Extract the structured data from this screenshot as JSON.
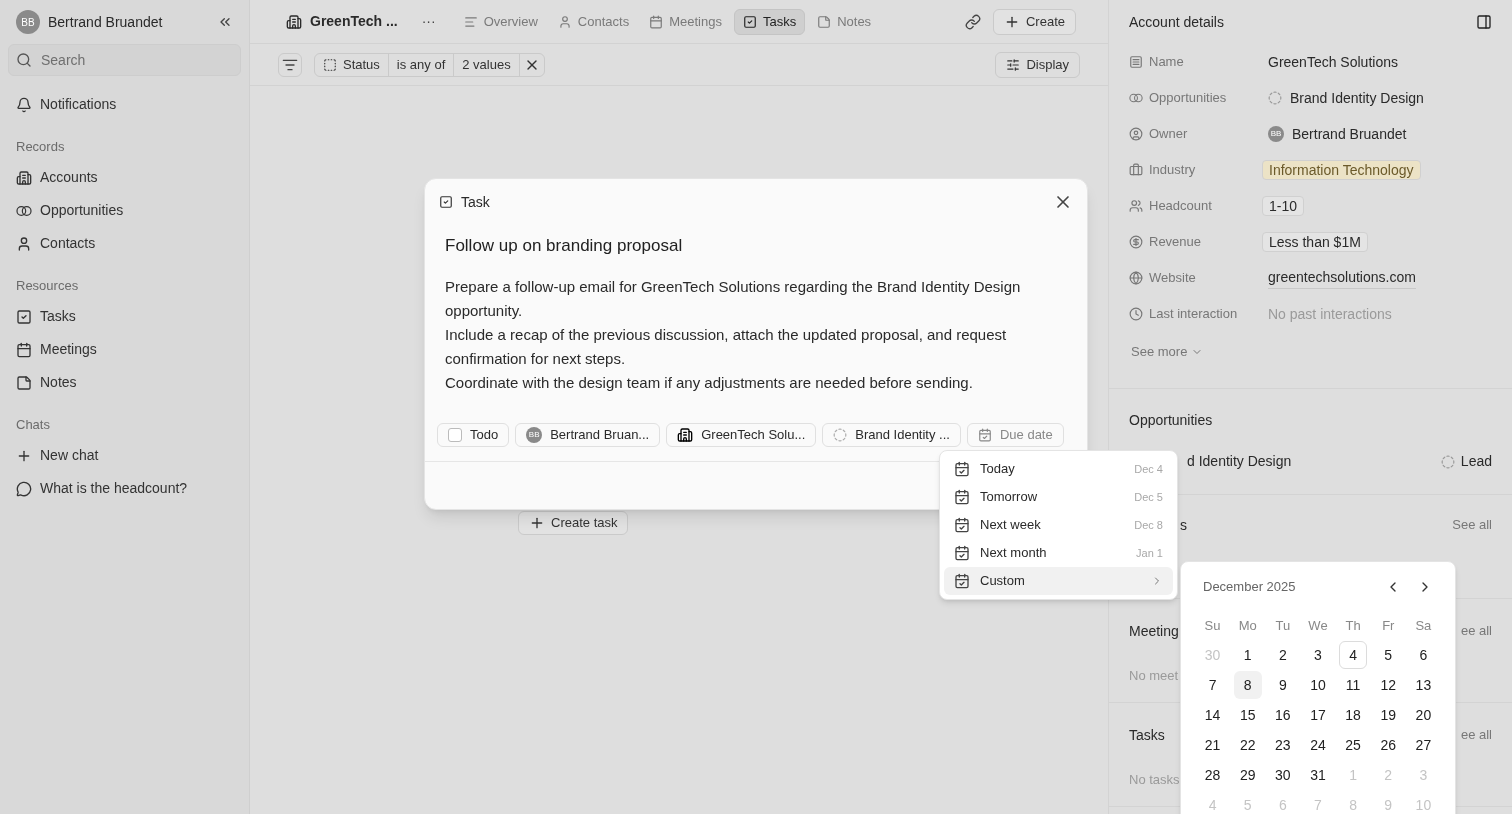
{
  "sidebar": {
    "user": {
      "initials": "BB",
      "name": "Bertrand Bruandet"
    },
    "search": {
      "placeholder": "Search"
    },
    "notifications": "Notifications",
    "sections": [
      {
        "title": "Records",
        "items": [
          "Accounts",
          "Opportunities",
          "Contacts"
        ]
      },
      {
        "title": "Resources",
        "items": [
          "Tasks",
          "Meetings",
          "Notes"
        ]
      },
      {
        "title": "Chats",
        "items": [
          "New chat",
          "What is the headcount?"
        ]
      }
    ]
  },
  "topbar": {
    "record": "GreenTech ...",
    "more": "···",
    "tabs": [
      {
        "label": "Overview",
        "selected": false
      },
      {
        "label": "Contacts",
        "selected": false
      },
      {
        "label": "Meetings",
        "selected": false
      },
      {
        "label": "Tasks",
        "selected": true
      },
      {
        "label": "Notes",
        "selected": false
      }
    ],
    "create": "Create"
  },
  "filter": {
    "field": "Status",
    "operator": "is any of",
    "value": "2 values",
    "display": "Display"
  },
  "create_task": "Create task",
  "task_modal": {
    "header": "Task",
    "title": "Follow up on branding proposal",
    "body": [
      "Prepare a follow-up email for GreenTech Solutions regarding the Brand Identity Design opportunity.",
      "Include a recap of the previous discussion, attach the updated proposal, and request confirmation for next steps.",
      "Coordinate with the design team if any adjustments are needed before sending."
    ],
    "chips": [
      {
        "kind": "status",
        "label": "Todo",
        "checked": false
      },
      {
        "kind": "owner",
        "label": "Bertrand Bruan...",
        "initials": "BB"
      },
      {
        "kind": "account",
        "label": "GreenTech Solu..."
      },
      {
        "kind": "opportunity",
        "label": "Brand Identity ..."
      },
      {
        "kind": "due",
        "label": "Due date"
      }
    ]
  },
  "due_menu": [
    {
      "label": "Today",
      "date": "Dec 4",
      "selected": false,
      "submenu": false
    },
    {
      "label": "Tomorrow",
      "date": "Dec 5",
      "selected": false,
      "submenu": false
    },
    {
      "label": "Next week",
      "date": "Dec 8",
      "selected": false,
      "submenu": false
    },
    {
      "label": "Next month",
      "date": "Jan 1",
      "selected": false,
      "submenu": false
    },
    {
      "label": "Custom",
      "selected": true,
      "submenu": true
    }
  ],
  "calendar": {
    "month": "December 2025",
    "weekdays": [
      "Su",
      "Mo",
      "Tu",
      "We",
      "Th",
      "Fr",
      "Sa"
    ],
    "weeks": [
      [
        {
          "label": "30",
          "outside": true,
          "today": false,
          "selected": false
        },
        {
          "label": "1",
          "outside": false,
          "today": false,
          "selected": false
        },
        {
          "label": "2",
          "outside": false,
          "today": false,
          "selected": false
        },
        {
          "label": "3",
          "outside": false,
          "today": false,
          "selected": false
        },
        {
          "label": "4",
          "outside": false,
          "today": true,
          "selected": false
        },
        {
          "label": "5",
          "outside": false,
          "today": false,
          "selected": false
        },
        {
          "label": "6",
          "outside": false,
          "today": false,
          "selected": false
        }
      ],
      [
        {
          "label": "7",
          "outside": false,
          "today": false,
          "selected": false
        },
        {
          "label": "8",
          "outside": false,
          "today": false,
          "selected": true
        },
        {
          "label": "9",
          "outside": false,
          "today": false,
          "selected": false
        },
        {
          "label": "10",
          "outside": false,
          "today": false,
          "selected": false
        },
        {
          "label": "11",
          "outside": false,
          "today": false,
          "selected": false
        },
        {
          "label": "12",
          "outside": false,
          "today": false,
          "selected": false
        },
        {
          "label": "13",
          "outside": false,
          "today": false,
          "selected": false
        }
      ],
      [
        {
          "label": "14",
          "outside": false,
          "today": false,
          "selected": false
        },
        {
          "label": "15",
          "outside": false,
          "today": false,
          "selected": false
        },
        {
          "label": "16",
          "outside": false,
          "today": false,
          "selected": false
        },
        {
          "label": "17",
          "outside": false,
          "today": false,
          "selected": false
        },
        {
          "label": "18",
          "outside": false,
          "today": false,
          "selected": false
        },
        {
          "label": "19",
          "outside": false,
          "today": false,
          "selected": false
        },
        {
          "label": "20",
          "outside": false,
          "today": false,
          "selected": false
        }
      ],
      [
        {
          "label": "21",
          "outside": false,
          "today": false,
          "selected": false
        },
        {
          "label": "22",
          "outside": false,
          "today": false,
          "selected": false
        },
        {
          "label": "23",
          "outside": false,
          "today": false,
          "selected": false
        },
        {
          "label": "24",
          "outside": false,
          "today": false,
          "selected": false
        },
        {
          "label": "25",
          "outside": false,
          "today": false,
          "selected": false
        },
        {
          "label": "26",
          "outside": false,
          "today": false,
          "selected": false
        },
        {
          "label": "27",
          "outside": false,
          "today": false,
          "selected": false
        }
      ],
      [
        {
          "label": "28",
          "outside": false,
          "today": false,
          "selected": false
        },
        {
          "label": "29",
          "outside": false,
          "today": false,
          "selected": false
        },
        {
          "label": "30",
          "outside": false,
          "today": false,
          "selected": false
        },
        {
          "label": "31",
          "outside": false,
          "today": false,
          "selected": false
        },
        {
          "label": "1",
          "outside": true,
          "today": false,
          "selected": false
        },
        {
          "label": "2",
          "outside": true,
          "today": false,
          "selected": false
        },
        {
          "label": "3",
          "outside": true,
          "today": false,
          "selected": false
        }
      ],
      [
        {
          "label": "4",
          "outside": true,
          "today": false,
          "selected": false
        },
        {
          "label": "5",
          "outside": true,
          "today": false,
          "selected": false
        },
        {
          "label": "6",
          "outside": true,
          "today": false,
          "selected": false
        },
        {
          "label": "7",
          "outside": true,
          "today": false,
          "selected": false
        },
        {
          "label": "8",
          "outside": true,
          "today": false,
          "selected": false
        },
        {
          "label": "9",
          "outside": true,
          "today": false,
          "selected": false
        },
        {
          "label": "10",
          "outside": true,
          "today": false,
          "selected": false
        }
      ]
    ]
  },
  "account_details": {
    "title": "Account details",
    "fields": [
      {
        "kind": "text",
        "label": "Name",
        "value": "GreenTech Solutions"
      },
      {
        "kind": "opportunity",
        "label": "Opportunities",
        "value": "Brand Identity Design"
      },
      {
        "kind": "person",
        "label": "Owner",
        "value": "Bertrand Bruandet",
        "initials": "BB"
      },
      {
        "kind": "tag",
        "label": "Industry",
        "value": "Information Technology",
        "color": "#ece3c6"
      },
      {
        "kind": "tag",
        "label": "Headcount",
        "value": "1-10",
        "color": "#e4e4e4"
      },
      {
        "kind": "tag",
        "label": "Revenue",
        "value": "Less than $1M",
        "color": "#e4e4e4"
      },
      {
        "kind": "link",
        "label": "Website",
        "value": "greentechsolutions.com"
      },
      {
        "kind": "empty",
        "label": "Last interaction",
        "value": "No past interactions"
      }
    ],
    "see_more": "See more"
  },
  "opportunities": {
    "title": "Opportunities",
    "row": {
      "name": "d Identity Design",
      "stage": "Lead"
    }
  },
  "contacts": {
    "title": "s",
    "see_all": "See all"
  },
  "meetings": {
    "title": "Meeting",
    "see_all": "ee all",
    "empty": "No meet"
  },
  "tasks": {
    "title": "Tasks",
    "see_all": "ee all",
    "empty": "No tasks"
  }
}
